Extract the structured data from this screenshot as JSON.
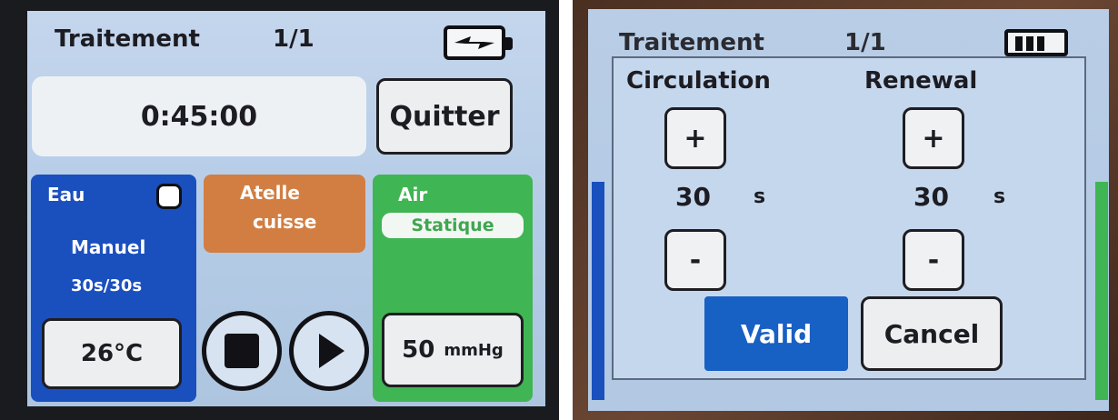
{
  "left_screen": {
    "header": {
      "title": "Traitement",
      "page": "1/1"
    },
    "timer": "0:45:00",
    "quit_label": "Quitter",
    "water": {
      "title": "Eau",
      "mode": "Manuel",
      "cycle": "30s/30s",
      "temperature": "26°C"
    },
    "splint": {
      "line1": "Atelle",
      "line2": "cuisse"
    },
    "air": {
      "title": "Air",
      "mode": "Statique",
      "pressure_value": "50",
      "pressure_unit": "mmHg"
    },
    "colors": {
      "water_panel": "#1a4fbe",
      "air_panel": "#3fb553",
      "splint_panel": "#d27e42"
    }
  },
  "right_screen": {
    "header": {
      "title": "Traitement",
      "page": "1/1"
    },
    "dialog": {
      "circulation": {
        "label": "Circulation",
        "plus": "+",
        "minus": "-",
        "value": "30",
        "unit": "s"
      },
      "renewal": {
        "label": "Renewal",
        "plus": "+",
        "minus": "-",
        "value": "30",
        "unit": "s"
      },
      "valid_label": "Valid",
      "cancel_label": "Cancel"
    },
    "colors": {
      "valid_button": "#1760c4"
    }
  }
}
